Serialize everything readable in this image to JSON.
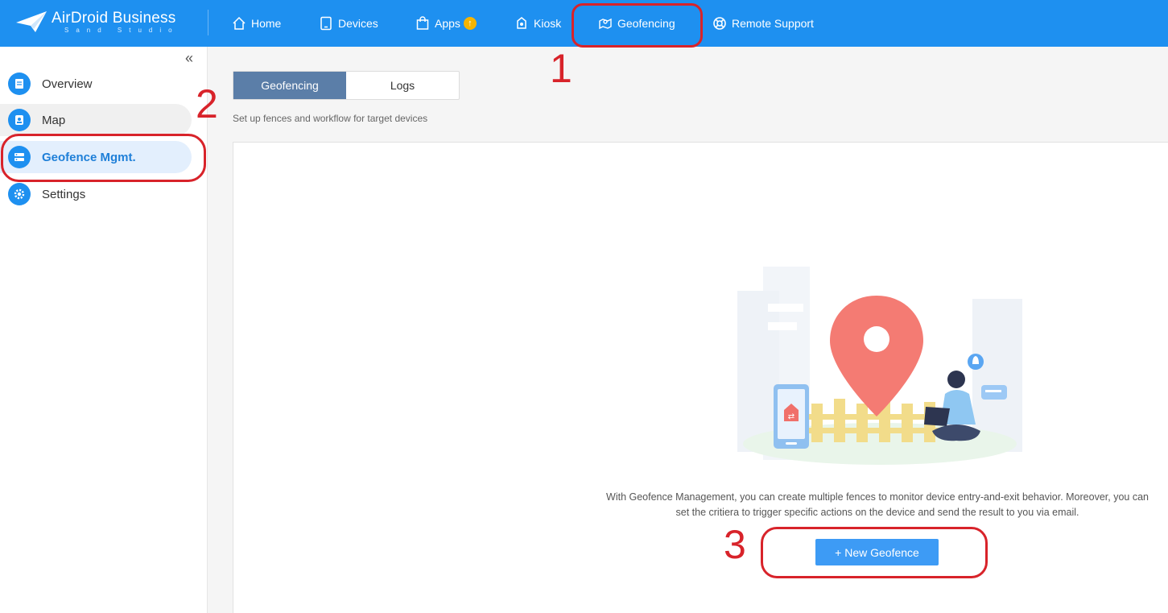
{
  "header": {
    "logo_title": "AirDroid Business",
    "logo_sub": "Sand Studio",
    "nav": [
      {
        "label": "Home",
        "icon": "home-icon"
      },
      {
        "label": "Devices",
        "icon": "tablet-icon"
      },
      {
        "label": "Apps",
        "icon": "bag-icon",
        "badge": "↑"
      },
      {
        "label": "Kiosk",
        "icon": "kiosk-icon"
      },
      {
        "label": "Geofencing",
        "icon": "map-icon"
      },
      {
        "label": "Remote Support",
        "icon": "lifebuoy-icon"
      }
    ]
  },
  "sidebar": {
    "items": [
      {
        "label": "Overview",
        "icon": "document-icon"
      },
      {
        "label": "Map",
        "icon": "map-pin-icon"
      },
      {
        "label": "Geofence Mgmt.",
        "icon": "server-icon",
        "active": true
      },
      {
        "label": "Settings",
        "icon": "gear-icon"
      }
    ]
  },
  "main": {
    "tabs": [
      {
        "label": "Geofencing",
        "active": true
      },
      {
        "label": "Logs",
        "active": false
      }
    ],
    "description": "Set up fences and workflow for target devices",
    "info_text": "With Geofence Management, you can create multiple fences to monitor device entry-and-exit behavior. Moreover, you can set the critiera to trigger specific actions on the device and send the result to you via email.",
    "button_label": "+ New Geofence"
  },
  "annotations": {
    "step1": "1",
    "step2": "2",
    "step3": "3"
  },
  "colors": {
    "topbar": "#1e90f0",
    "accent": "#3d9bf5",
    "annotation": "#d8232a",
    "tab_active": "#5b7ea8"
  }
}
